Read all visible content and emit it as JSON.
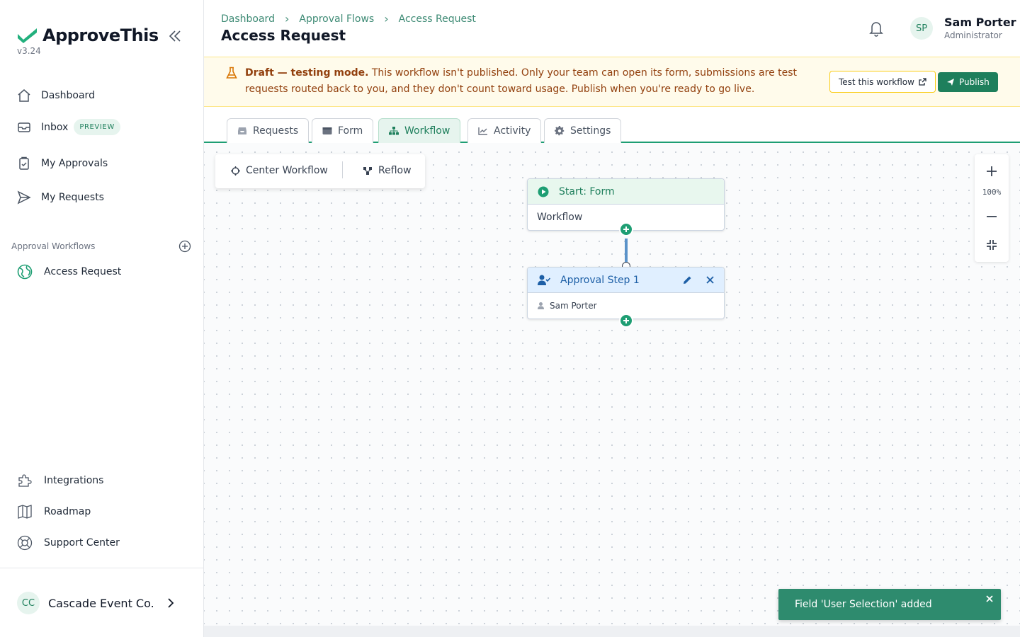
{
  "app": {
    "name": "ApproveThis",
    "version": "v3.24",
    "brand_color": "#1e9e73"
  },
  "sidebar": {
    "nav": [
      {
        "label": "Dashboard",
        "icon": "home-icon"
      },
      {
        "label": "Inbox",
        "icon": "inbox-icon",
        "badge": "PREVIEW"
      },
      {
        "label": "My Approvals",
        "icon": "clipboard-check-icon"
      },
      {
        "label": "My Requests",
        "icon": "send-icon"
      }
    ],
    "section_label": "Approval Workflows",
    "workflows": [
      {
        "label": "Access Request",
        "icon": "workflow-globe-icon"
      }
    ],
    "bottom_nav": [
      {
        "label": "Integrations",
        "icon": "puzzle-icon"
      },
      {
        "label": "Roadmap",
        "icon": "map-icon"
      },
      {
        "label": "Support Center",
        "icon": "lifebuoy-icon"
      }
    ],
    "org": {
      "initials": "CC",
      "name": "Cascade Event Co."
    }
  },
  "header": {
    "breadcrumb": [
      "Dashboard",
      "Approval Flows",
      "Access Request"
    ],
    "title": "Access Request",
    "user": {
      "initials": "SP",
      "name": "Sam Porter",
      "role": "Administrator"
    }
  },
  "banner": {
    "strong": "Draft — testing mode.",
    "text": " This workflow isn't published. Only your team can open its form, submissions are test requests routed back to you, and they don't count toward usage. Publish when you're ready to go live.",
    "test_button": "Test this workflow",
    "publish_button": "Publish"
  },
  "tabs": [
    {
      "label": "Requests",
      "icon": "inbox-tray-icon",
      "active": false
    },
    {
      "label": "Form",
      "icon": "form-icon",
      "active": false
    },
    {
      "label": "Workflow",
      "icon": "sitemap-icon",
      "active": true
    },
    {
      "label": "Activity",
      "icon": "chart-line-icon",
      "active": false
    },
    {
      "label": "Settings",
      "icon": "gear-icon",
      "active": false
    }
  ],
  "canvas": {
    "toolbar": {
      "center": "Center Workflow",
      "reflow": "Reflow"
    },
    "start_node": {
      "title": "Start: Form",
      "body": "Workflow"
    },
    "approval_node": {
      "title": "Approval Step 1",
      "approver": "Sam Porter"
    },
    "zoom": "100%"
  },
  "toast": {
    "message": "Field 'User Selection' added"
  }
}
